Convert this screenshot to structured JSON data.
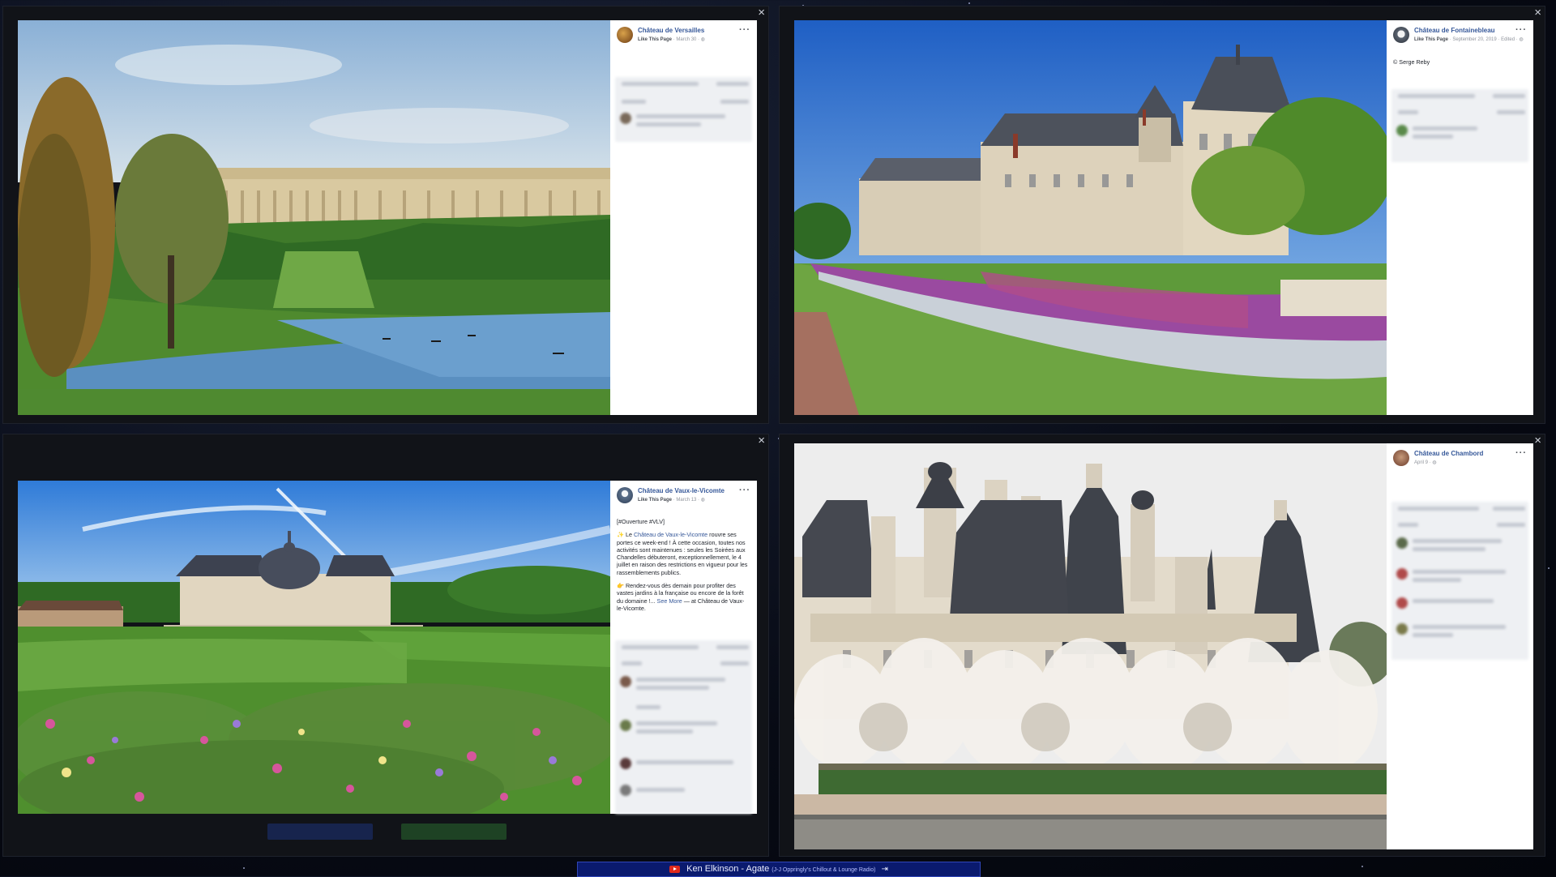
{
  "posts": [
    {
      "id": "versailles",
      "page_name": "Château de Versailles",
      "like_label": "Like This Page",
      "date": "March 30",
      "edited": "",
      "text": []
    },
    {
      "id": "fontainebleau",
      "page_name": "Château de Fontainebleau",
      "like_label": "Like This Page",
      "date": "September 20, 2019",
      "edited": "Edited",
      "text": [
        "© Serge Reby"
      ]
    },
    {
      "id": "vaux",
      "page_name": "Château de Vaux-le-Vicomte",
      "like_label": "Like This Page",
      "date": "March 13",
      "edited": "",
      "hashtag": "[#Ouverture #VLV]",
      "p1_pre": "✨ Le ",
      "p1_link": "Château de Vaux-le-Vicomte",
      "p1_post": " rouvre ses portes ce week-end ! À cette occasion, toutes nos activités sont maintenues : seules les Soirées aux Chandelles débuteront, exceptionnellement, le 4 juillet en raison des restrictions en vigueur pour les rassemblements publics.",
      "p2_pre": "👉 Rendez-vous dès demain pour profiter des vastes jardins à la française ou encore de la forêt du domaine !... ",
      "p2_more": "See More",
      "p2_post": " — at Château de Vaux-le-Vicomte."
    },
    {
      "id": "chambord",
      "page_name": "Château de Chambord",
      "like_label": "",
      "date": "April 9",
      "edited": "",
      "text": []
    }
  ],
  "window": {
    "close_glyph": "×",
    "more_glyph": "···"
  },
  "music_bar": {
    "artist_track": "Ken Elkinson - Agate",
    "station": "(J-J Oppringly's Chillout & Lounge Radio)",
    "open_glyph": "⇥"
  },
  "colors": {
    "fb_blue": "#365899",
    "panel_bg": "#ffffff",
    "music_bg": "#0a1a6e"
  }
}
